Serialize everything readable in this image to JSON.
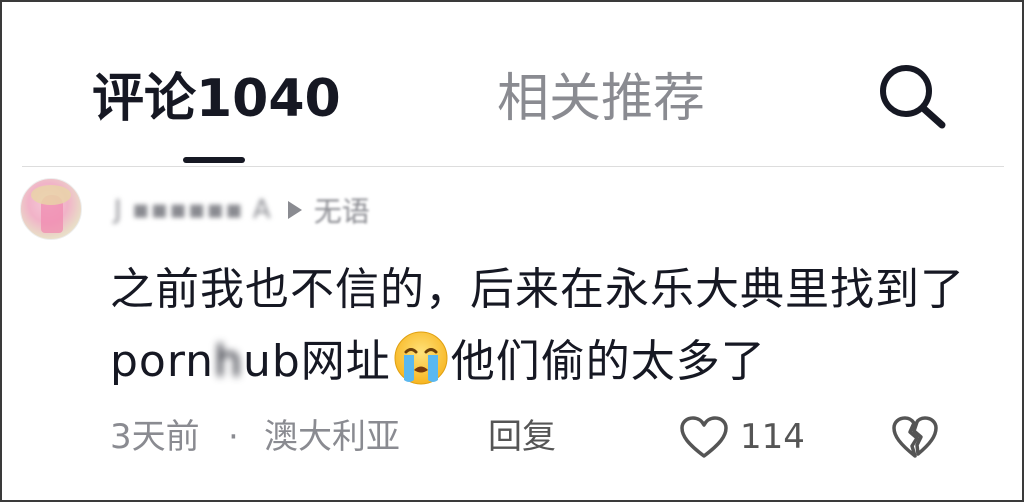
{
  "tabs": {
    "comments_label": "评论1040",
    "related_label": "相关推荐"
  },
  "icons": {
    "search": "search-icon",
    "like": "heart-outline-icon",
    "dislike": "broken-heart-icon",
    "emoji": "crying-face-emoji",
    "play": "play-triangle-icon"
  },
  "comment": {
    "username": "J ▪▪▪▪▪▪ A",
    "sub_label": "无语",
    "text_part1": "之前我也不信的，后来在永乐大典里找到了porn",
    "text_blur": "h",
    "text_part2": "ub网址",
    "text_part3": "他们偷的太多了",
    "time": "3天前",
    "separator": "·",
    "location": "澳大利亚",
    "reply_label": "回复",
    "like_count": "114"
  },
  "colors": {
    "primary_text": "#161823",
    "secondary_text": "#8a8b91",
    "divider": "#dddddd",
    "background": "#ffffff"
  }
}
